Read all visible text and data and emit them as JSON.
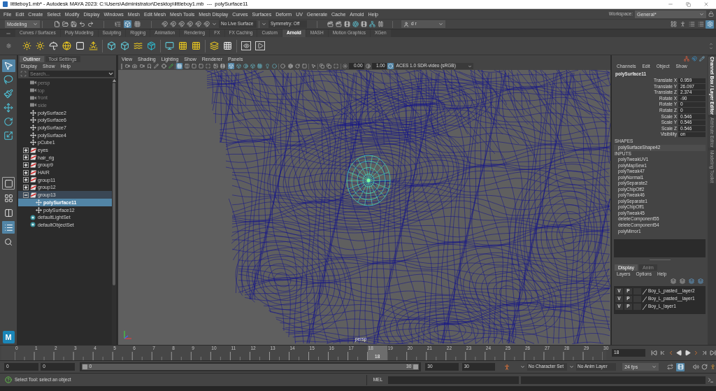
{
  "window": {
    "title": "littleboy1.mb* - Autodesk MAYA 2023: C:\\Users\\Administrator\\Desktop\\littleboy1.mb  ---  polySurface11"
  },
  "menu_bar": {
    "items": [
      "File",
      "Edit",
      "Create",
      "Select",
      "Modify",
      "Display",
      "Windows",
      "Mesh",
      "Edit Mesh",
      "Mesh Tools",
      "Mesh Display",
      "Curves",
      "Surfaces",
      "Deform",
      "UV",
      "Generate",
      "Cache",
      "Arnold",
      "Help"
    ],
    "workspace_label": "Workspace:",
    "workspace": "General*"
  },
  "status_line": {
    "menu_set": "Modeling",
    "select_modes": [
      {
        "selected": false
      },
      {
        "selected": true
      },
      {
        "selected": false
      }
    ],
    "live_surface": "No Live Surface",
    "symmetry": "Symmetry: Off",
    "user": "d r",
    "panel_toggles": [
      {
        "on": false
      },
      {
        "on": false
      },
      {
        "on": false
      },
      {
        "on": false
      },
      {
        "on": true
      }
    ]
  },
  "shelf": {
    "tabs": [
      {
        "label": "Curves / Surfaces",
        "selected": false
      },
      {
        "label": "Poly Modeling",
        "selected": false
      },
      {
        "label": "Sculpting",
        "selected": false
      },
      {
        "label": "Rigging",
        "selected": false
      },
      {
        "label": "Animation",
        "selected": false
      },
      {
        "label": "Rendering",
        "selected": false
      },
      {
        "label": "FX",
        "selected": false
      },
      {
        "label": "FX Caching",
        "selected": false
      },
      {
        "label": "Custom",
        "selected": false
      },
      {
        "label": "Arnold",
        "selected": true
      },
      {
        "label": "MASH",
        "selected": false
      },
      {
        "label": "Motion Graphics",
        "selected": false
      },
      {
        "label": "XGen",
        "selected": false
      }
    ]
  },
  "toolbox": {
    "tools": [
      {
        "selected": true
      },
      {
        "selected": false
      },
      {
        "selected": false
      },
      {
        "selected": false
      },
      {
        "selected": false
      },
      {
        "selected": false
      }
    ],
    "layouts": [
      {
        "selected": false
      },
      {
        "selected": false
      },
      {
        "selected": false
      },
      {
        "selected": true
      }
    ],
    "logo": "M"
  },
  "outliner": {
    "tabs": [
      {
        "label": "Outliner",
        "selected": true
      },
      {
        "label": "Tool Settings",
        "selected": false
      }
    ],
    "menu": [
      "Display",
      "Show",
      "Help"
    ],
    "search": {
      "placeholder": "Search..."
    },
    "items": [
      {
        "label": "persp",
        "kind": "camera",
        "selected": false
      },
      {
        "label": "top",
        "kind": "camera",
        "selected": false
      },
      {
        "label": "front",
        "kind": "camera",
        "selected": false
      },
      {
        "label": "side",
        "kind": "camera",
        "selected": false
      },
      {
        "label": "polySurface2",
        "kind": "mesh",
        "selected": false
      },
      {
        "label": "polySurface6",
        "kind": "mesh",
        "selected": false
      },
      {
        "label": "polySurface7",
        "kind": "mesh",
        "selected": false
      },
      {
        "label": "polySurface4",
        "kind": "mesh",
        "selected": false
      },
      {
        "label": "pCube1",
        "kind": "mesh",
        "selected": false
      },
      {
        "label": "eyes",
        "kind": "group",
        "expanded": false,
        "selected": false
      },
      {
        "label": "hair_rig",
        "kind": "group",
        "expanded": false,
        "selected": false
      },
      {
        "label": "group9",
        "kind": "group",
        "expanded": false,
        "selected": false
      },
      {
        "label": "HAIR",
        "kind": "group",
        "expanded": false,
        "selected": false
      },
      {
        "label": "group11",
        "kind": "group",
        "expanded": false,
        "selected": false
      },
      {
        "label": "group12",
        "kind": "group",
        "expanded": false,
        "selected": false
      },
      {
        "label": "group13",
        "kind": "group",
        "expanded": true,
        "selected": false,
        "children": [
          {
            "label": "polySurface11",
            "kind": "mesh",
            "selected": true
          },
          {
            "label": "polySurface12",
            "kind": "mesh",
            "selected": false
          }
        ]
      },
      {
        "label": "defaultLightSet",
        "kind": "set",
        "selected": false
      },
      {
        "label": "defaultObjectSet",
        "kind": "set",
        "selected": false
      }
    ]
  },
  "viewport": {
    "menu": [
      "View",
      "Shading",
      "Lighting",
      "Show",
      "Renderer",
      "Panels"
    ],
    "toolbar": [
      {
        "on": false
      },
      {
        "on": false
      },
      {
        "on": false
      },
      {
        "on": false
      },
      {
        "on": false
      },
      {
        "on": false
      },
      {
        "on": false
      },
      {
        "on": true
      },
      {
        "on": false
      },
      {
        "on": false
      },
      {
        "on": false
      },
      {
        "on": false
      },
      {
        "on": false
      },
      {
        "on": false
      },
      {
        "on": true
      },
      {
        "on": false
      },
      {
        "on": false
      },
      {
        "on": false
      },
      {
        "on": false
      },
      {
        "on": false
      },
      {
        "on": false
      },
      {
        "on": false
      },
      {
        "on": false
      },
      {
        "on": false
      },
      {
        "on": false
      },
      {
        "on": false
      },
      {
        "on": false
      },
      {
        "on": false
      },
      {
        "on": false
      },
      {
        "on": false
      },
      {
        "on": false
      },
      {
        "on": true
      }
    ],
    "exposure": "0.00",
    "gamma": "1.00",
    "color_space": "ACES 1.0 SDR-video (sRGB)",
    "camera": "persp"
  },
  "channel_box": {
    "menu": [
      "Channels",
      "Edit",
      "Object",
      "Show"
    ],
    "object": "polySurface11",
    "attributes": [
      {
        "name": "Translate X",
        "value": "0.959"
      },
      {
        "name": "Translate Y",
        "value": "26.097"
      },
      {
        "name": "Translate Z",
        "value": "2.374"
      },
      {
        "name": "Rotate X",
        "value": "-90"
      },
      {
        "name": "Rotate Y",
        "value": "0"
      },
      {
        "name": "Rotate Z",
        "value": "0"
      },
      {
        "name": "Scale X",
        "value": "0.546"
      },
      {
        "name": "Scale Y",
        "value": "0.546"
      },
      {
        "name": "Scale Z",
        "value": "0.546"
      },
      {
        "name": "Visibility",
        "value": "on"
      }
    ],
    "shapes_heading": "SHAPES",
    "shapes": [
      "polySurfaceShape42"
    ],
    "inputs_heading": "INPUTS",
    "inputs": [
      "polyTweakUV1",
      "polyMapSew1",
      "polyTweak47",
      "polyNormal1",
      "polySeparate2",
      "polyChipOff2",
      "polyTweak46",
      "polySeparate1",
      "polyChipOff1",
      "polyTweak45",
      "deleteComponent55",
      "deleteComponent54",
      "polyMirror1"
    ]
  },
  "layer_editor": {
    "tabs": [
      {
        "label": "Display",
        "selected": true
      },
      {
        "label": "Anim",
        "selected": false
      }
    ],
    "menu": [
      "Layers",
      "Options",
      "Help"
    ],
    "layers": [
      {
        "visibility": "V",
        "playback": "P",
        "name": "Boy_L_pasted__layer2"
      },
      {
        "visibility": "V",
        "playback": "P",
        "name": "Boy_L_pasted__layer1"
      },
      {
        "visibility": "V",
        "playback": "P",
        "name": "Boy_L_layer1"
      }
    ]
  },
  "side_tabs": [
    {
      "label": "Channel Box / Layer Editor",
      "selected": true
    },
    {
      "label": "Attribute Editor",
      "selected": false
    },
    {
      "label": "Modeling Toolkit",
      "selected": false
    }
  ],
  "time_slider": {
    "ticks": [
      "0",
      "1",
      "2",
      "3",
      "4",
      "5",
      "6",
      "7",
      "8",
      "9",
      "10",
      "11",
      "12",
      "13",
      "14",
      "15",
      "16",
      "17",
      "18",
      "19",
      "20",
      "21",
      "22",
      "23",
      "24",
      "25",
      "26",
      "27",
      "28",
      "29",
      "30"
    ],
    "level": 0.6,
    "current_frame": "18",
    "frame_field": "18"
  },
  "range_slider": {
    "start": "0",
    "playback_start": "0",
    "level": 1,
    "range_start": "0",
    "range_end": "30",
    "playback_end": "30",
    "end": "30",
    "character_set": "No Character Set",
    "anim_layer": "No Anim Layer",
    "fps": "24 fps",
    "playback_options": [
      {
        "on": false
      },
      {
        "on": true
      }
    ]
  },
  "help_line": {
    "message": "Select Tool: select an object",
    "language": "MEL"
  }
}
